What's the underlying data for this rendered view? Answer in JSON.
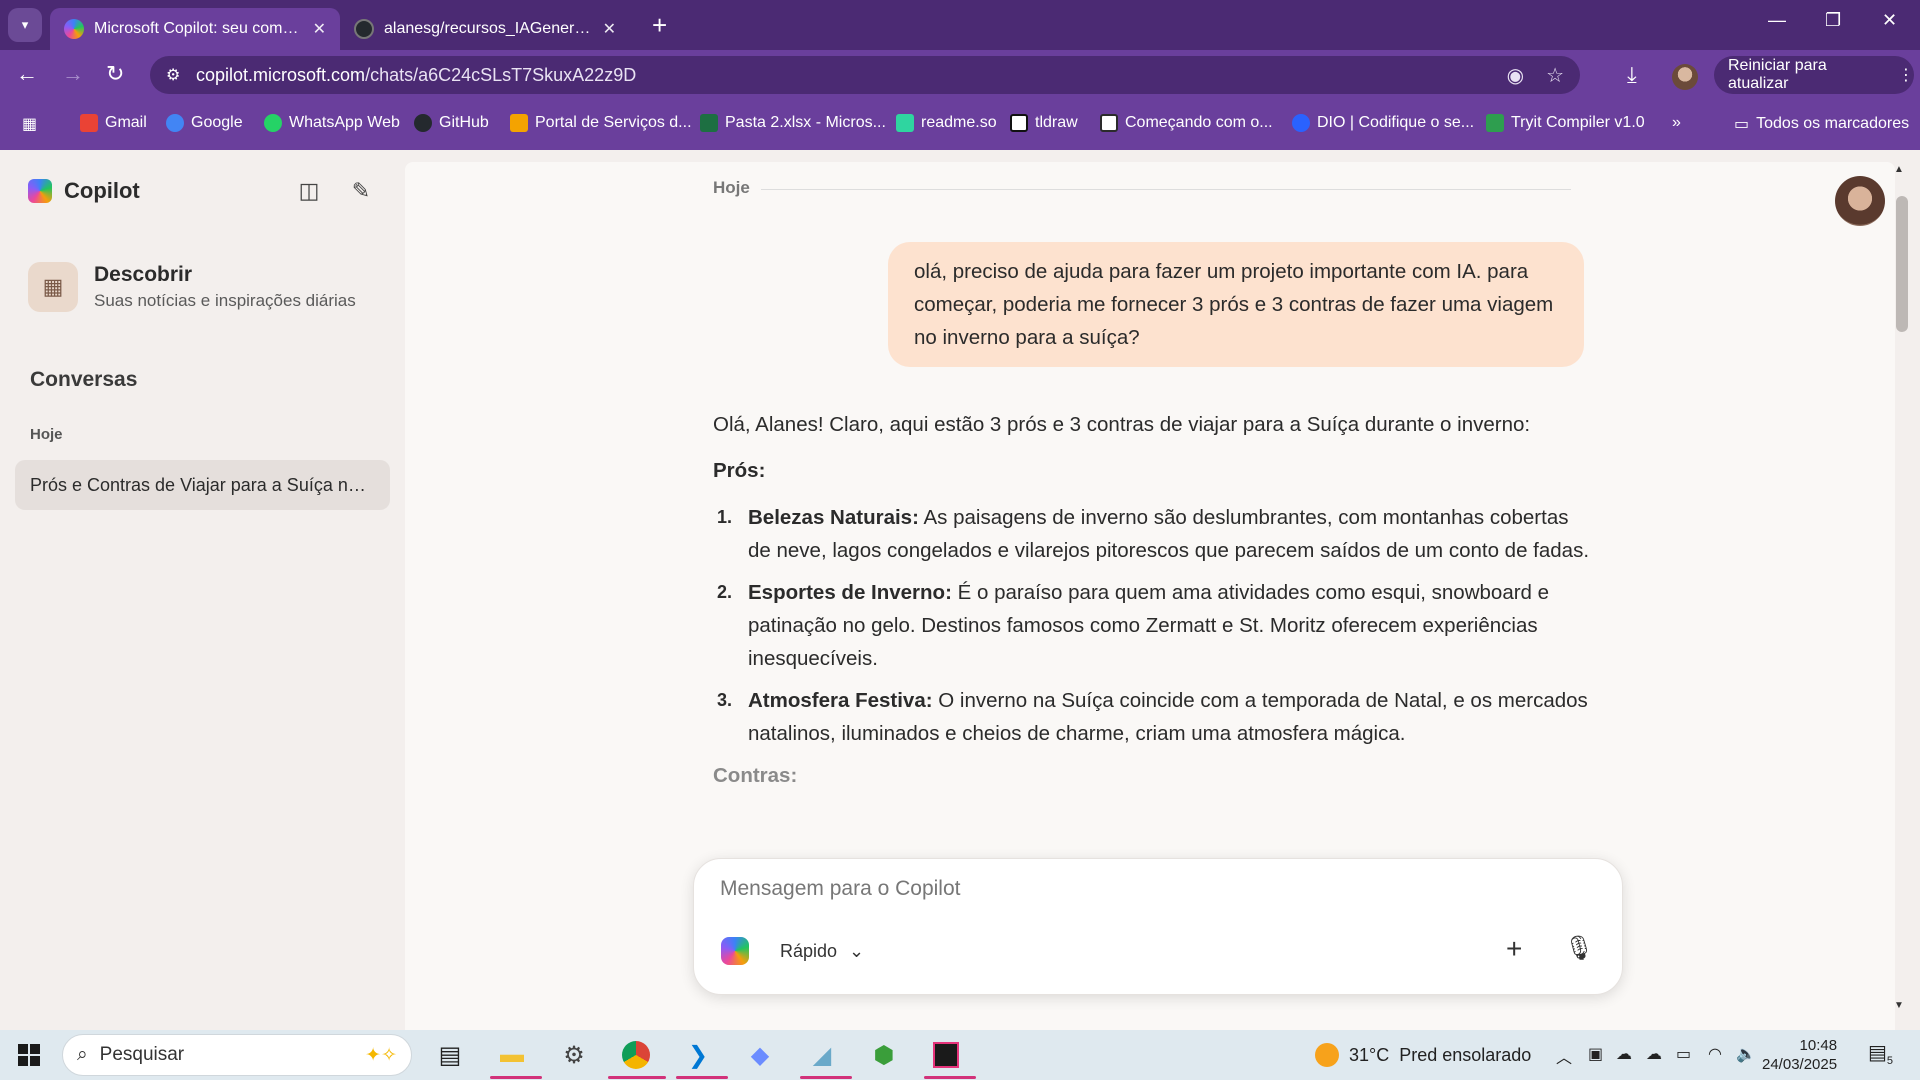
{
  "browser": {
    "tabs": [
      {
        "title": "Microsoft Copilot: seu companheiro",
        "active": true
      },
      {
        "title": "alanesg/recursos_IAGenerativa",
        "active": false
      }
    ],
    "url_host": "copilot.microsoft.com",
    "url_path": "/chats/a6C24cSLsT7SkuxA22z9D",
    "update_button": "Reiniciar para atualizar",
    "bookmarks": [
      "Gmail",
      "Google",
      "WhatsApp Web",
      "GitHub",
      "Portal de Serviços d...",
      "Pasta 2.xlsx - Micros...",
      "readme.so",
      "tldraw",
      "Começando com o...",
      "DIO | Codifique o se...",
      "Tryit Compiler v1.0"
    ],
    "all_bookmarks": "Todos os marcadores",
    "bookmark_colors": [
      "#ea4335",
      "#4285f4",
      "#25d366",
      "#24292e",
      "#f4a300",
      "#1d6f42",
      "#2fd5a0",
      "#111111",
      "#2b2b2b",
      "#2a62ff",
      "#2e9e4f"
    ]
  },
  "sidebar": {
    "brand": "Copilot",
    "discover_title": "Descobrir",
    "discover_subtitle": "Suas notícias e inspirações diárias",
    "conversations_title": "Conversas",
    "group_today": "Hoje",
    "conversation_item": "Prós e Contras de Viajar para a Suíça no Inverno"
  },
  "chat": {
    "date_divider": "Hoje",
    "user_message": "olá, preciso de ajuda para fazer um projeto importante com IA. para começar, poderia me fornecer 3 prós e 3 contras de fazer uma viagem no inverno para a suíça?",
    "intro": "Olá, Alanes! Claro, aqui estão 3 prós e 3 contras de viajar para a Suíça durante o inverno:",
    "pros_heading": "Prós:",
    "pros": [
      {
        "num": "1.",
        "term": "Belezas Naturais:",
        "text": " As paisagens de inverno são deslumbrantes, com montanhas cobertas de neve, lagos congelados e vilarejos pitorescos que parecem saídos de um conto de fadas."
      },
      {
        "num": "2.",
        "term": "Esportes de Inverno:",
        "text": " É o paraíso para quem ama atividades como esqui, snowboard e patinação no gelo. Destinos famosos como Zermatt e St. Moritz oferecem experiências inesquecíveis."
      },
      {
        "num": "3.",
        "term": "Atmosfera Festiva:",
        "text": " O inverno na Suíça coincide com a temporada de Natal, e os mercados natalinos, iluminados e cheios de charme, criam uma atmosfera mágica."
      }
    ],
    "cons_heading": "Contras:"
  },
  "composer": {
    "placeholder": "Mensagem para o Copilot",
    "mode": "Rápido"
  },
  "taskbar": {
    "search_placeholder": "Pesquisar",
    "weather_temp": "31°C",
    "weather_text": "Pred ensolarado",
    "time": "10:48",
    "date": "24/03/2025",
    "notification_count": "5"
  }
}
